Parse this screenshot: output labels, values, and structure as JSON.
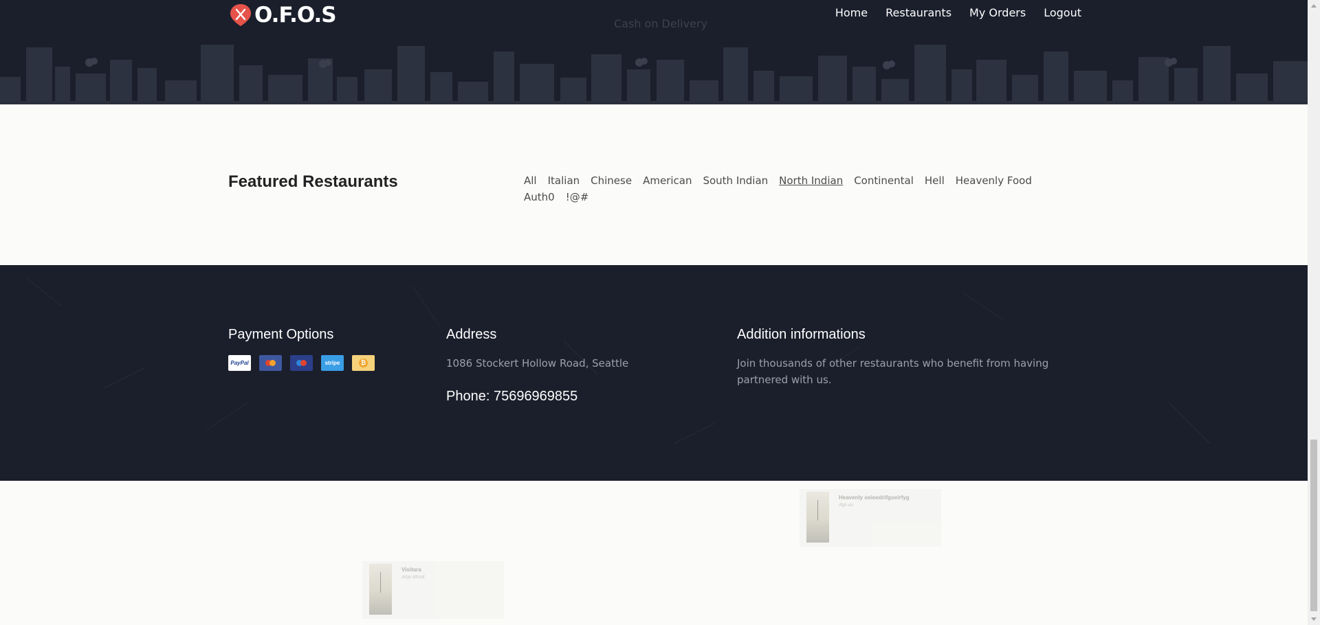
{
  "header": {
    "logo_text": "O.F.O.S",
    "faded_text": "Cash on Delivery",
    "nav": [
      "Home",
      "Restaurants",
      "My Orders",
      "Logout"
    ]
  },
  "featured": {
    "title": "Featured Restaurants",
    "filters": [
      "All",
      "Italian",
      "Chinese",
      "American",
      "South Indian",
      "North Indian",
      "Continental",
      "Hell",
      "Heavenly Food",
      "Auth0",
      "!@#"
    ],
    "active_filter": "North Indian"
  },
  "footer": {
    "payment": {
      "title": "Payment Options",
      "cards": [
        "PayPal",
        "Mastercard",
        "Maestro",
        "stripe",
        "Bitcoin"
      ],
      "paypal_label": "PayPal",
      "stripe_label": "stripe"
    },
    "address": {
      "title": "Address",
      "text": "1086 Stockert Hollow Road, Seattle",
      "phone": "Phone: 75696969855"
    },
    "info": {
      "title": "Addition informations",
      "text": "Join thousands of other restaurants who benefit from having partnered with us."
    }
  },
  "previews": [
    {
      "name": "Heavenly oeioedrifgoeirfyg",
      "sub": "dfgh als"
    },
    {
      "name": "Visitara",
      "sub": "skfgh dlfhsdf"
    }
  ],
  "colors": {
    "header_bg": "#1b1f2c",
    "page_bg": "#fbfbf9",
    "logo_accent": "#e5534b"
  }
}
